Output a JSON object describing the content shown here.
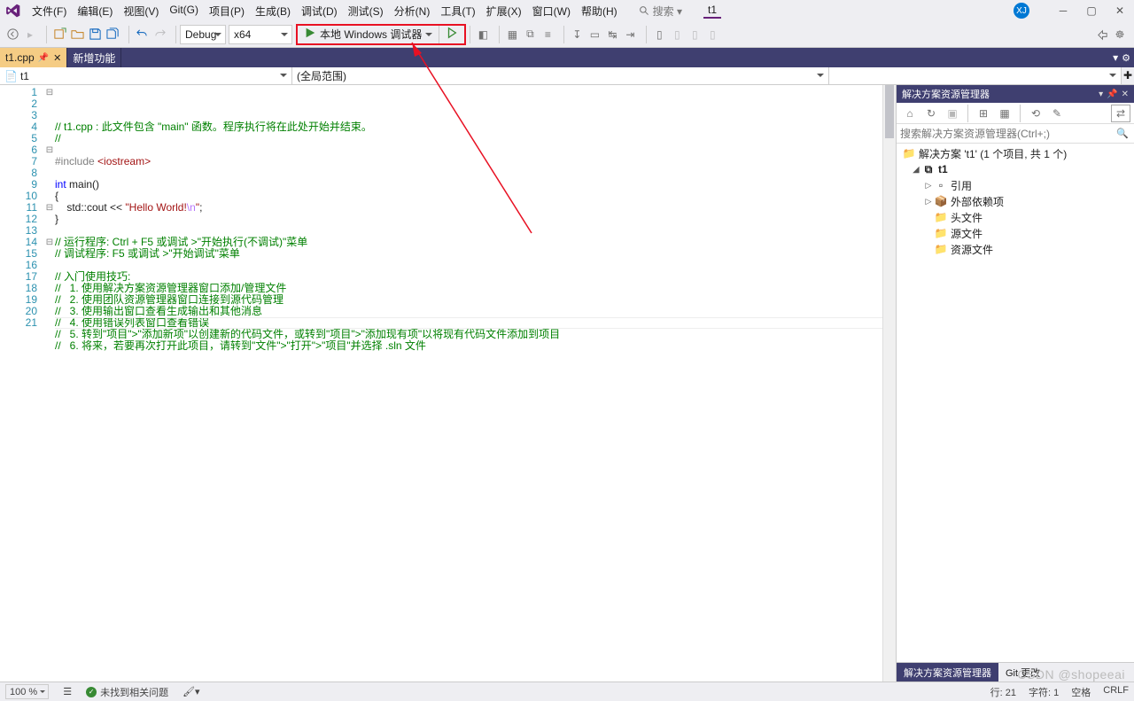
{
  "menu": [
    "文件(F)",
    "编辑(E)",
    "视图(V)",
    "Git(G)",
    "项目(P)",
    "生成(B)",
    "调试(D)",
    "测试(S)",
    "分析(N)",
    "工具(T)",
    "扩展(X)",
    "窗口(W)",
    "帮助(H)"
  ],
  "search_placeholder": "搜索 ▾",
  "title_tag": "t1",
  "account_initial": "XJ",
  "toolbar": {
    "config": "Debug",
    "platform": "x64",
    "debugger_label": "本地 Windows 调试器"
  },
  "tabs": [
    {
      "label": "t1.cpp",
      "active": true,
      "pinned": true
    },
    {
      "label": "新增功能",
      "active": false
    }
  ],
  "nav": {
    "left": "t1",
    "right": "(全局范围)"
  },
  "code": {
    "lines": [
      {
        "n": 1,
        "fold": "⊟",
        "seg": [
          {
            "c": "c-comment",
            "t": "// t1.cpp : 此文件包含 \"main\" 函数。程序执行将在此处开始并结束。"
          }
        ]
      },
      {
        "n": 2,
        "seg": [
          {
            "c": "c-comment",
            "t": "//"
          }
        ]
      },
      {
        "n": 3,
        "seg": []
      },
      {
        "n": 4,
        "seg": [
          {
            "c": "c-pre",
            "t": "#include "
          },
          {
            "c": "c-string",
            "t": "<iostream>"
          }
        ]
      },
      {
        "n": 5,
        "seg": []
      },
      {
        "n": 6,
        "fold": "⊟",
        "seg": [
          {
            "c": "c-keyword",
            "t": "int"
          },
          {
            "t": " main()"
          }
        ]
      },
      {
        "n": 7,
        "seg": [
          {
            "t": "{"
          }
        ]
      },
      {
        "n": 8,
        "seg": [
          {
            "t": "    std::cout << "
          },
          {
            "c": "c-string",
            "t": "\"Hello World!"
          },
          {
            "c": "c-escape",
            "t": "\\n"
          },
          {
            "c": "c-string",
            "t": "\""
          },
          {
            "t": ";"
          }
        ]
      },
      {
        "n": 9,
        "seg": [
          {
            "t": "}"
          }
        ]
      },
      {
        "n": 10,
        "seg": []
      },
      {
        "n": 11,
        "fold": "⊟",
        "seg": [
          {
            "c": "c-comment",
            "t": "// 运行程序: Ctrl + F5 或调试 >\"开始执行(不调试)\"菜单"
          }
        ]
      },
      {
        "n": 12,
        "seg": [
          {
            "c": "c-comment",
            "t": "// 调试程序: F5 或调试 >\"开始调试\"菜单"
          }
        ]
      },
      {
        "n": 13,
        "seg": []
      },
      {
        "n": 14,
        "fold": "⊟",
        "seg": [
          {
            "c": "c-comment",
            "t": "// 入门使用技巧: "
          }
        ]
      },
      {
        "n": 15,
        "seg": [
          {
            "c": "c-comment",
            "t": "//   1. 使用解决方案资源管理器窗口添加/管理文件"
          }
        ]
      },
      {
        "n": 16,
        "seg": [
          {
            "c": "c-comment",
            "t": "//   2. 使用团队资源管理器窗口连接到源代码管理"
          }
        ]
      },
      {
        "n": 17,
        "seg": [
          {
            "c": "c-comment",
            "t": "//   3. 使用输出窗口查看生成输出和其他消息"
          }
        ]
      },
      {
        "n": 18,
        "seg": [
          {
            "c": "c-comment",
            "t": "//   4. 使用错误列表窗口查看错误"
          }
        ]
      },
      {
        "n": 19,
        "seg": [
          {
            "c": "c-comment",
            "t": "//   5. 转到\"项目\">\"添加新项\"以创建新的代码文件，或转到\"项目\">\"添加现有项\"以将现有代码文件添加到项目"
          }
        ]
      },
      {
        "n": 20,
        "seg": [
          {
            "c": "c-comment",
            "t": "//   6. 将来，若要再次打开此项目，请转到\"文件\">\"打开\">\"项目\"并选择 .sln 文件"
          }
        ]
      },
      {
        "n": 21,
        "seg": []
      }
    ],
    "current_line_index": 20
  },
  "solution": {
    "header": "解决方案资源管理器",
    "search_placeholder": "搜索解决方案资源管理器(Ctrl+;)",
    "root": "解决方案 't1' (1 个项目, 共 1 个)",
    "project": "t1",
    "nodes": [
      "引用",
      "外部依赖项",
      "头文件",
      "源文件",
      "资源文件"
    ],
    "bottom_tabs": [
      "解决方案资源管理器",
      "Git 更改"
    ]
  },
  "status": {
    "zoom": "100 %",
    "issues": "未找到相关问题",
    "line": "行: 21",
    "char": "字符: 1",
    "space": "空格",
    "crlf": "CRLF"
  },
  "watermark": "CSDN @shopeeai"
}
